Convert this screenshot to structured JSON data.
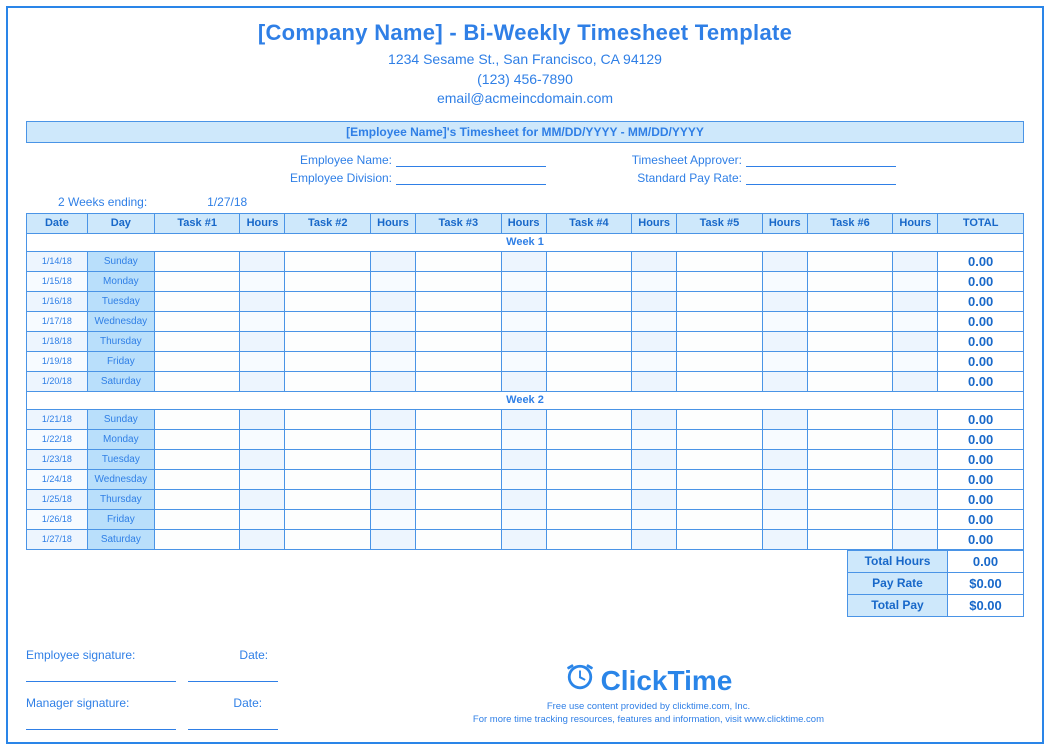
{
  "title": "[Company Name] - Bi-Weekly Timesheet Template",
  "address_line1": "1234 Sesame St.,  San Francisco, CA 94129",
  "address_line2": "(123) 456-7890",
  "address_line3": "email@acmeincdomain.com",
  "banner": "[Employee Name]'s Timesheet for MM/DD/YYYY - MM/DD/YYYY",
  "field_labels": {
    "emp_name": "Employee Name:",
    "emp_div": "Employee Division:",
    "approver": "Timesheet Approver:",
    "pay_rate": "Standard Pay Rate:"
  },
  "two_weeks_label": "2 Weeks ending:",
  "two_weeks_value": "1/27/18",
  "columns": [
    "Date",
    "Day",
    "Task #1",
    "Hours",
    "Task #2",
    "Hours",
    "Task #3",
    "Hours",
    "Task #4",
    "Hours",
    "Task #5",
    "Hours",
    "Task #6",
    "Hours",
    "TOTAL"
  ],
  "week1_label": "Week 1",
  "week2_label": "Week 2",
  "week1": [
    {
      "date": "1/14/18",
      "day": "Sunday",
      "total": "0.00"
    },
    {
      "date": "1/15/18",
      "day": "Monday",
      "total": "0.00"
    },
    {
      "date": "1/16/18",
      "day": "Tuesday",
      "total": "0.00"
    },
    {
      "date": "1/17/18",
      "day": "Wednesday",
      "total": "0.00"
    },
    {
      "date": "1/18/18",
      "day": "Thursday",
      "total": "0.00"
    },
    {
      "date": "1/19/18",
      "day": "Friday",
      "total": "0.00"
    },
    {
      "date": "1/20/18",
      "day": "Saturday",
      "total": "0.00"
    }
  ],
  "week2": [
    {
      "date": "1/21/18",
      "day": "Sunday",
      "total": "0.00"
    },
    {
      "date": "1/22/18",
      "day": "Monday",
      "total": "0.00"
    },
    {
      "date": "1/23/18",
      "day": "Tuesday",
      "total": "0.00"
    },
    {
      "date": "1/24/18",
      "day": "Wednesday",
      "total": "0.00"
    },
    {
      "date": "1/25/18",
      "day": "Thursday",
      "total": "0.00"
    },
    {
      "date": "1/26/18",
      "day": "Friday",
      "total": "0.00"
    },
    {
      "date": "1/27/18",
      "day": "Saturday",
      "total": "0.00"
    }
  ],
  "summary": {
    "total_hours_label": "Total Hours",
    "total_hours": "0.00",
    "pay_rate_label": "Pay Rate",
    "pay_rate": "$0.00",
    "total_pay_label": "Total Pay",
    "total_pay": "$0.00"
  },
  "sig": {
    "emp": "Employee signature:",
    "mgr": "Manager signature:",
    "date": "Date:"
  },
  "logo_text": "ClickTime",
  "credit1": "Free use content provided by clicktime.com, Inc.",
  "credit2": "For more time tracking resources, features and information, visit www.clicktime.com"
}
